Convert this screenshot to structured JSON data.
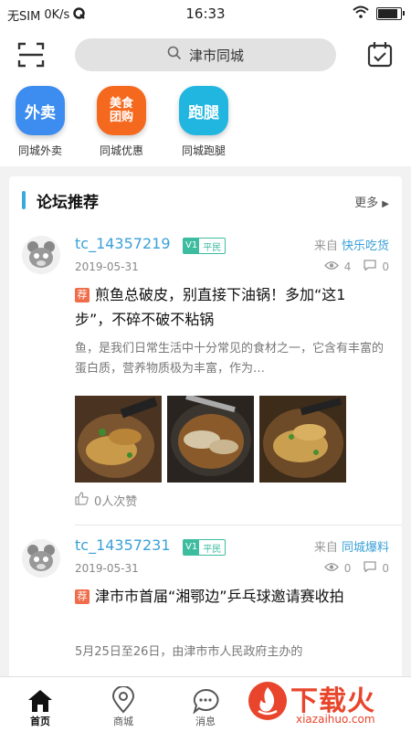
{
  "status_bar": {
    "carrier": "无SIM",
    "speed": "0K/s",
    "time": "16:33"
  },
  "search": {
    "placeholder": "津市同城"
  },
  "shortcuts": [
    {
      "icon_text": "外卖",
      "label": "同城外卖",
      "color": "#3d8cf0"
    },
    {
      "icon_text": "美食\n团购",
      "label": "同城优惠",
      "color": "#f5691f"
    },
    {
      "icon_text": "跑腿",
      "label": "同城跑腿",
      "color": "#21b6e0"
    }
  ],
  "forum": {
    "title": "论坛推荐",
    "more": "更多",
    "posts": [
      {
        "username": "tc_14357219",
        "level_v": "V1",
        "level_text": "平民",
        "from_prefix": "来自",
        "category": "快乐吃货",
        "date": "2019-05-31",
        "views": "4",
        "comments": "0",
        "tag": "荐",
        "title": "煎鱼总破皮，别直接下油锅！多加“这1步”，不碎不破不粘锅",
        "excerpt": "鱼，是我们日常生活中十分常见的食材之一，它含有丰富的蛋白质，营养物质极为丰富，作为…",
        "likes": "0人次赞"
      },
      {
        "username": "tc_14357231",
        "level_v": "V1",
        "level_text": "平民",
        "from_prefix": "来自",
        "category": "同城爆料",
        "date": "2019-05-31",
        "views": "0",
        "comments": "0",
        "tag": "荐",
        "title": "津市市首届“湘鄂边”乒乓球邀请赛收拍",
        "excerpt": "5月25日至26日，由津市市人民政府主办的"
      }
    ]
  },
  "tabbar": [
    {
      "label": "首页"
    },
    {
      "label": "商城"
    },
    {
      "label": "消息"
    }
  ],
  "watermark": {
    "text": "下载火",
    "sub": "xiazaihuo.com"
  }
}
